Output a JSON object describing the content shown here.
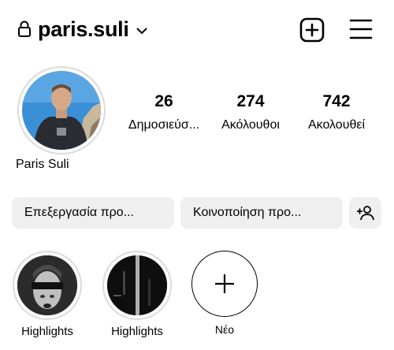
{
  "header": {
    "username": "paris.suli",
    "lock_icon": "lock-icon",
    "dropdown_icon": "chevron-down-icon",
    "new_post_icon": "plus-square-icon",
    "menu_icon": "hamburger-menu-icon"
  },
  "profile": {
    "display_name": "Paris Suli",
    "avatar_icon": "profile-photo"
  },
  "stats": [
    {
      "count": "26",
      "label": "Δημοσιεύσ..."
    },
    {
      "count": "274",
      "label": "Ακόλουθοι"
    },
    {
      "count": "742",
      "label": "Ακολουθεί"
    }
  ],
  "actions": {
    "edit_profile": "Επεξεργασία προ...",
    "share_profile": "Κοινοποίηση προ...",
    "discover_people_icon": "add-person-icon"
  },
  "highlights": [
    {
      "label": "Highlights"
    },
    {
      "label": "Highlights"
    },
    {
      "label": "Νέο"
    }
  ],
  "colors": {
    "button_bg": "#efefef",
    "ring": "#dbdbdb",
    "text": "#000000"
  }
}
